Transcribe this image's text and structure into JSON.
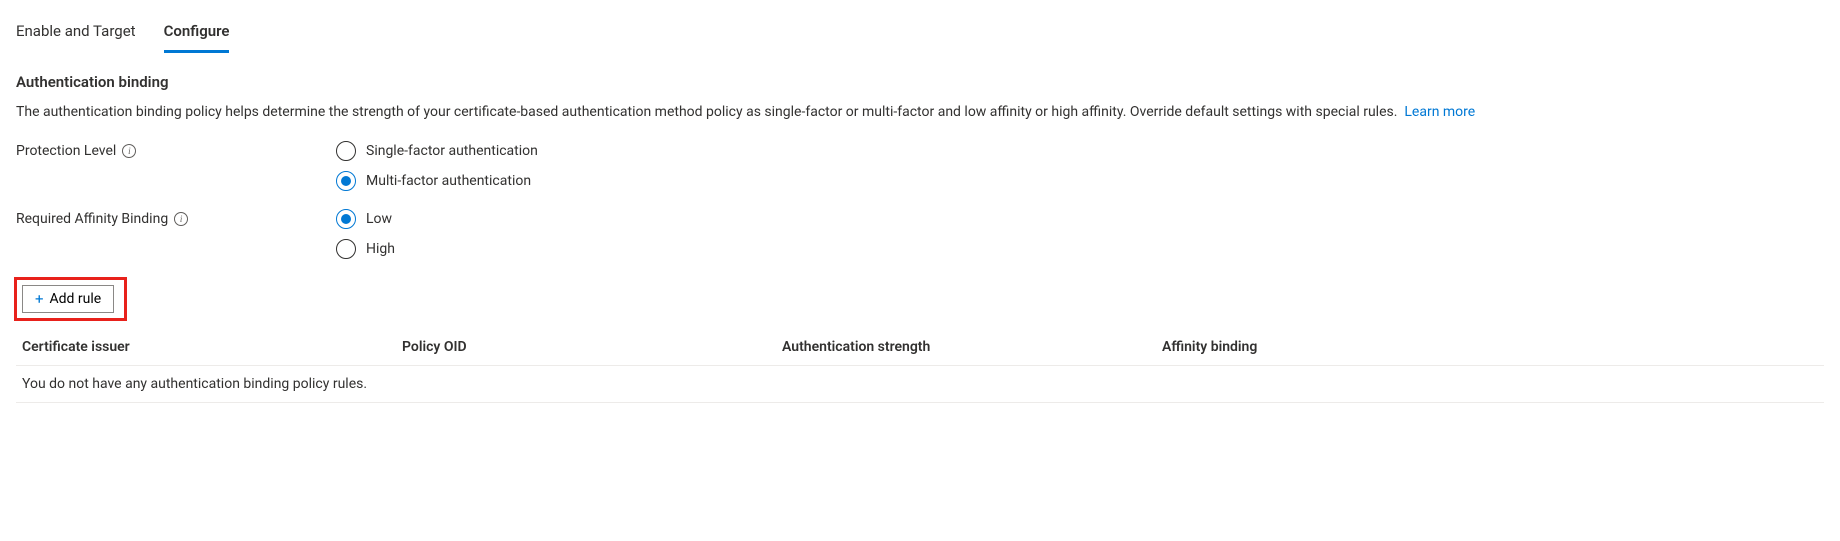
{
  "tabs": {
    "enable": "Enable and Target",
    "configure": "Configure"
  },
  "section_title": "Authentication binding",
  "description": "The authentication binding policy helps determine the strength of your certificate-based authentication method policy as single-factor or multi-factor and low affinity or high affinity. Override default settings with special rules.",
  "learn_more": "Learn more",
  "protection": {
    "label": "Protection Level",
    "options": {
      "single": "Single-factor authentication",
      "multi": "Multi-factor authentication"
    }
  },
  "affinity": {
    "label": "Required Affinity Binding",
    "options": {
      "low": "Low",
      "high": "High"
    }
  },
  "add_rule": "Add rule",
  "columns": {
    "issuer": "Certificate issuer",
    "oid": "Policy OID",
    "strength": "Authentication strength",
    "affinity": "Affinity binding"
  },
  "empty_message": "You do not have any authentication binding policy rules."
}
